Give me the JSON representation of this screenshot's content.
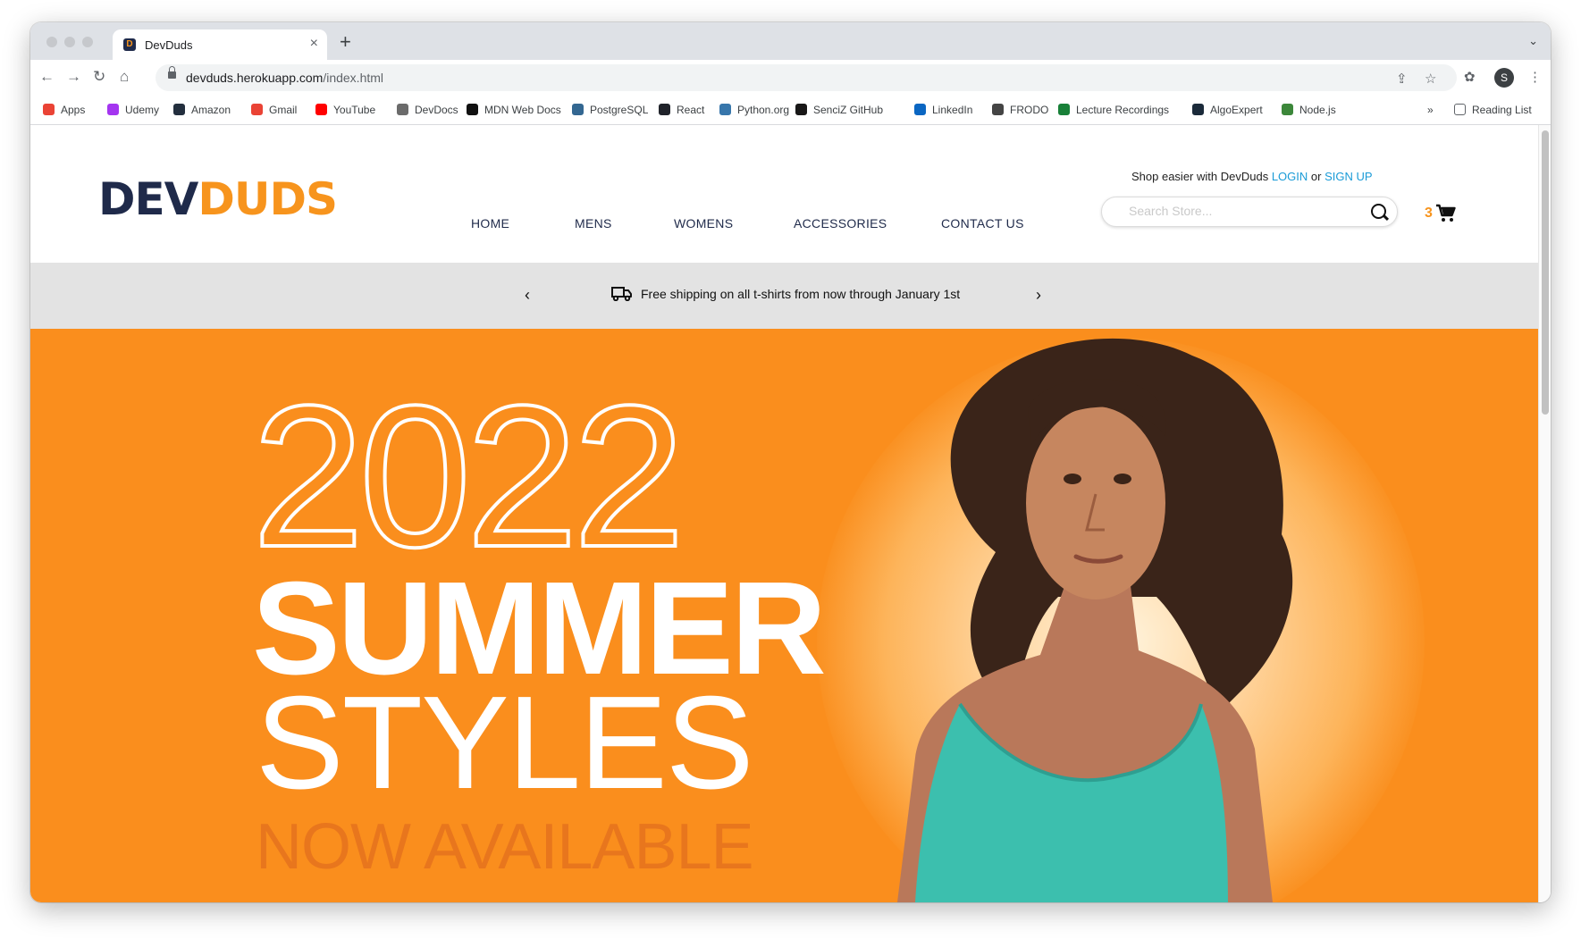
{
  "browser": {
    "tab_title": "DevDuds",
    "url_host": "devduds.herokuapp.com",
    "url_path": "/index.html",
    "profile_initial": "S"
  },
  "bookmarks": [
    {
      "label": "Apps",
      "color": "#ea4335"
    },
    {
      "label": "Udemy",
      "color": "#a435f0"
    },
    {
      "label": "Amazon",
      "color": "#232f3e"
    },
    {
      "label": "Gmail",
      "color": "#ea4335"
    },
    {
      "label": "YouTube",
      "color": "#ff0000"
    },
    {
      "label": "DevDocs",
      "color": "#6b6b6b"
    },
    {
      "label": "MDN Web Docs",
      "color": "#111111"
    },
    {
      "label": "PostgreSQL",
      "color": "#336791"
    },
    {
      "label": "React",
      "color": "#20232a"
    },
    {
      "label": "Python.org",
      "color": "#3776ab"
    },
    {
      "label": "SenciZ GitHub",
      "color": "#181717"
    },
    {
      "label": "LinkedIn",
      "color": "#0a66c2"
    },
    {
      "label": "FRODO",
      "color": "#444444"
    },
    {
      "label": "Lecture Recordings",
      "color": "#188038"
    },
    {
      "label": "AlgoExpert",
      "color": "#1b2a3a"
    },
    {
      "label": "Node.js",
      "color": "#3c873a"
    }
  ],
  "bookmarks_more": "»",
  "reading_list": "Reading List",
  "site": {
    "login_prompt": "Shop easier with DevDuds",
    "login": "LOGIN",
    "or": "or",
    "signup": "SIGN UP",
    "logo_dev": "DEV",
    "logo_duds": "DUDS",
    "nav": [
      "HOME",
      "MENS",
      "WOMENS",
      "ACCESSORIES",
      "CONTACT US"
    ],
    "search_placeholder": "Search Store...",
    "cart_count": "3",
    "banner_message": "Free shipping on all t-shirts from now through January 1st",
    "hero": {
      "year": "2022",
      "line1": "SUMMER",
      "line2": "STYLES",
      "line3": "NOW AVAILABLE"
    }
  },
  "colors": {
    "brand_navy": "#1f2a4a",
    "brand_orange": "#f7941d",
    "link_blue": "#1a9bd7",
    "hero_orange": "#fa8e1d"
  }
}
